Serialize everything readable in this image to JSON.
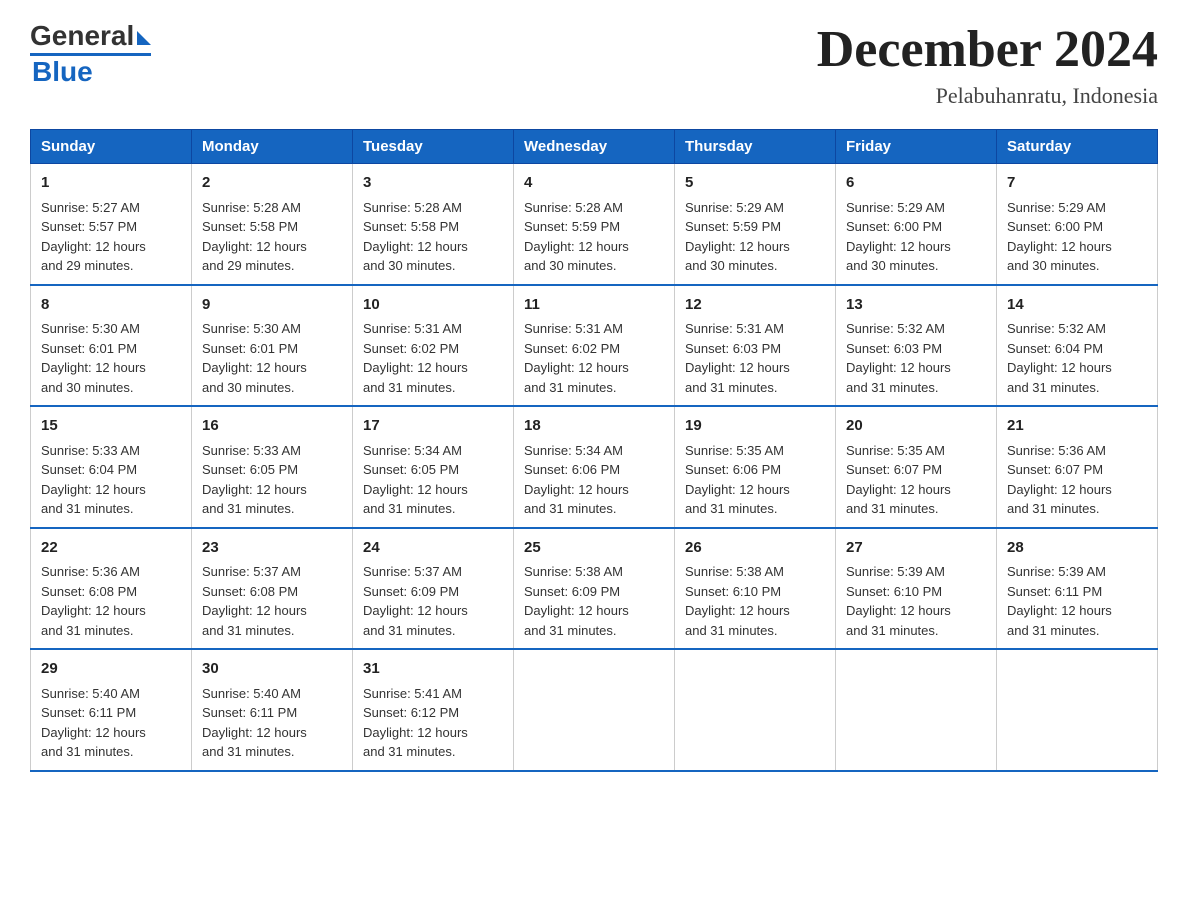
{
  "logo": {
    "general": "General",
    "triangle": "",
    "blue": "Blue"
  },
  "title": "December 2024",
  "subtitle": "Pelabuhanratu, Indonesia",
  "days": [
    "Sunday",
    "Monday",
    "Tuesday",
    "Wednesday",
    "Thursday",
    "Friday",
    "Saturday"
  ],
  "weeks": [
    [
      {
        "date": "1",
        "sunrise": "5:27 AM",
        "sunset": "5:57 PM",
        "daylight": "12 hours and 29 minutes."
      },
      {
        "date": "2",
        "sunrise": "5:28 AM",
        "sunset": "5:58 PM",
        "daylight": "12 hours and 29 minutes."
      },
      {
        "date": "3",
        "sunrise": "5:28 AM",
        "sunset": "5:58 PM",
        "daylight": "12 hours and 30 minutes."
      },
      {
        "date": "4",
        "sunrise": "5:28 AM",
        "sunset": "5:59 PM",
        "daylight": "12 hours and 30 minutes."
      },
      {
        "date": "5",
        "sunrise": "5:29 AM",
        "sunset": "5:59 PM",
        "daylight": "12 hours and 30 minutes."
      },
      {
        "date": "6",
        "sunrise": "5:29 AM",
        "sunset": "6:00 PM",
        "daylight": "12 hours and 30 minutes."
      },
      {
        "date": "7",
        "sunrise": "5:29 AM",
        "sunset": "6:00 PM",
        "daylight": "12 hours and 30 minutes."
      }
    ],
    [
      {
        "date": "8",
        "sunrise": "5:30 AM",
        "sunset": "6:01 PM",
        "daylight": "12 hours and 30 minutes."
      },
      {
        "date": "9",
        "sunrise": "5:30 AM",
        "sunset": "6:01 PM",
        "daylight": "12 hours and 30 minutes."
      },
      {
        "date": "10",
        "sunrise": "5:31 AM",
        "sunset": "6:02 PM",
        "daylight": "12 hours and 31 minutes."
      },
      {
        "date": "11",
        "sunrise": "5:31 AM",
        "sunset": "6:02 PM",
        "daylight": "12 hours and 31 minutes."
      },
      {
        "date": "12",
        "sunrise": "5:31 AM",
        "sunset": "6:03 PM",
        "daylight": "12 hours and 31 minutes."
      },
      {
        "date": "13",
        "sunrise": "5:32 AM",
        "sunset": "6:03 PM",
        "daylight": "12 hours and 31 minutes."
      },
      {
        "date": "14",
        "sunrise": "5:32 AM",
        "sunset": "6:04 PM",
        "daylight": "12 hours and 31 minutes."
      }
    ],
    [
      {
        "date": "15",
        "sunrise": "5:33 AM",
        "sunset": "6:04 PM",
        "daylight": "12 hours and 31 minutes."
      },
      {
        "date": "16",
        "sunrise": "5:33 AM",
        "sunset": "6:05 PM",
        "daylight": "12 hours and 31 minutes."
      },
      {
        "date": "17",
        "sunrise": "5:34 AM",
        "sunset": "6:05 PM",
        "daylight": "12 hours and 31 minutes."
      },
      {
        "date": "18",
        "sunrise": "5:34 AM",
        "sunset": "6:06 PM",
        "daylight": "12 hours and 31 minutes."
      },
      {
        "date": "19",
        "sunrise": "5:35 AM",
        "sunset": "6:06 PM",
        "daylight": "12 hours and 31 minutes."
      },
      {
        "date": "20",
        "sunrise": "5:35 AM",
        "sunset": "6:07 PM",
        "daylight": "12 hours and 31 minutes."
      },
      {
        "date": "21",
        "sunrise": "5:36 AM",
        "sunset": "6:07 PM",
        "daylight": "12 hours and 31 minutes."
      }
    ],
    [
      {
        "date": "22",
        "sunrise": "5:36 AM",
        "sunset": "6:08 PM",
        "daylight": "12 hours and 31 minutes."
      },
      {
        "date": "23",
        "sunrise": "5:37 AM",
        "sunset": "6:08 PM",
        "daylight": "12 hours and 31 minutes."
      },
      {
        "date": "24",
        "sunrise": "5:37 AM",
        "sunset": "6:09 PM",
        "daylight": "12 hours and 31 minutes."
      },
      {
        "date": "25",
        "sunrise": "5:38 AM",
        "sunset": "6:09 PM",
        "daylight": "12 hours and 31 minutes."
      },
      {
        "date": "26",
        "sunrise": "5:38 AM",
        "sunset": "6:10 PM",
        "daylight": "12 hours and 31 minutes."
      },
      {
        "date": "27",
        "sunrise": "5:39 AM",
        "sunset": "6:10 PM",
        "daylight": "12 hours and 31 minutes."
      },
      {
        "date": "28",
        "sunrise": "5:39 AM",
        "sunset": "6:11 PM",
        "daylight": "12 hours and 31 minutes."
      }
    ],
    [
      {
        "date": "29",
        "sunrise": "5:40 AM",
        "sunset": "6:11 PM",
        "daylight": "12 hours and 31 minutes."
      },
      {
        "date": "30",
        "sunrise": "5:40 AM",
        "sunset": "6:11 PM",
        "daylight": "12 hours and 31 minutes."
      },
      {
        "date": "31",
        "sunrise": "5:41 AM",
        "sunset": "6:12 PM",
        "daylight": "12 hours and 31 minutes."
      },
      null,
      null,
      null,
      null
    ]
  ],
  "labels": {
    "sunrise": "Sunrise:",
    "sunset": "Sunset:",
    "daylight": "Daylight:"
  }
}
